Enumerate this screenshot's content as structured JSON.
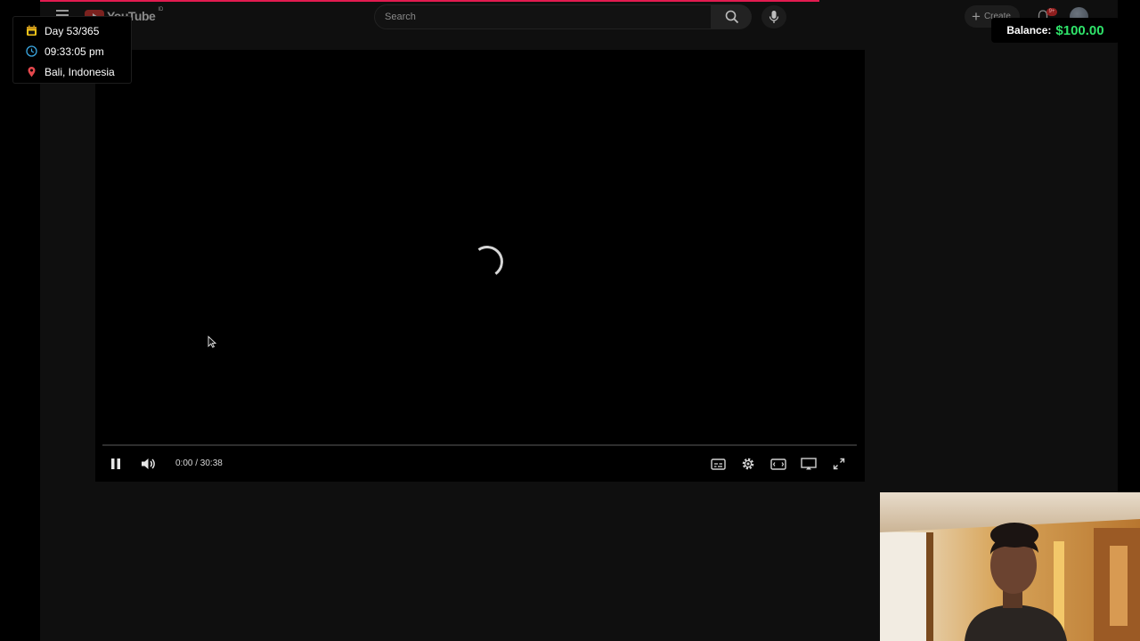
{
  "youtube": {
    "logo_text": "YouTube",
    "region_code": "ID",
    "search_placeholder": "Search",
    "create_label": "Create",
    "notification_count": "9+"
  },
  "player": {
    "time_display": "0:00 / 30:38",
    "playback_state": "loading",
    "progress_fraction": 0.0
  },
  "overlay": {
    "day": "Day 53/365",
    "time": "09:33:05 pm",
    "location": "Bali, Indonesia"
  },
  "balance": {
    "label": "Balance:",
    "amount": "$100.00"
  },
  "icons": {
    "menu": "menu-icon",
    "search": "search-icon",
    "mic": "mic-icon",
    "create": "plus-icon",
    "bell": "bell-icon",
    "pause": "pause-icon",
    "volume": "volume-icon",
    "captions": "captions-icon",
    "settings": "gear-icon",
    "theater": "theater-mode-icon",
    "cast": "cast-icon",
    "fullscreen": "fullscreen-icon",
    "calendar": "calendar-icon",
    "clock": "clock-icon",
    "location": "location-pin-icon"
  },
  "colors": {
    "accent_red": "#e21b4f",
    "balance_green": "#2fe36a",
    "calendar_yellow": "#f5c518",
    "clock_blue": "#3aa6e0",
    "pin_red": "#e5484d"
  }
}
